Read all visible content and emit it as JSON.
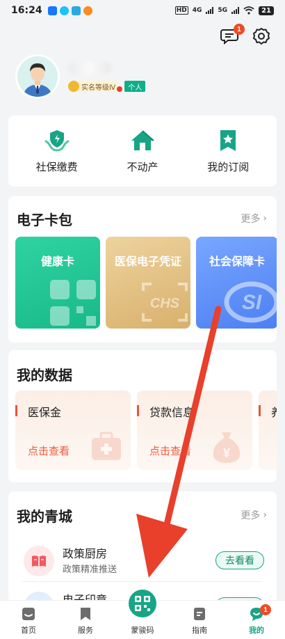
{
  "status": {
    "time": "16:24",
    "net1": "4G",
    "net2": "5G",
    "battery": "21",
    "hd": "HD"
  },
  "header": {
    "message_badge": "1"
  },
  "profile": {
    "level_badge": "实名等级Ⅳ",
    "type_badge": "个人"
  },
  "quick_actions": [
    {
      "label": "社保缴费",
      "icon": "shield-hand-icon"
    },
    {
      "label": "不动产",
      "icon": "house-icon"
    },
    {
      "label": "我的订阅",
      "icon": "bookmark-star-icon"
    }
  ],
  "wallet": {
    "title": "电子卡包",
    "more": "更多",
    "cards": [
      {
        "label": "健康卡",
        "color": "#1fc08f"
      },
      {
        "label": "医保电子凭证",
        "color": "#e2c07f"
      },
      {
        "label": "社会保障卡",
        "color": "#5b8cf5"
      }
    ]
  },
  "my_data": {
    "title": "我的数据",
    "items": [
      {
        "label": "医保金",
        "link": "点击查看"
      },
      {
        "label": "贷款信息",
        "link": "点击查看"
      },
      {
        "label": "养"
      }
    ]
  },
  "my_city": {
    "title": "我的青城",
    "more": "更多",
    "items": [
      {
        "title": "政策厨房",
        "subtitle": "政策精准推送",
        "button": "去看看"
      },
      {
        "title": "电子印章",
        "button": "去看看"
      }
    ]
  },
  "tabbar": {
    "items": [
      {
        "label": "首页"
      },
      {
        "label": "服务"
      },
      {
        "label": "蒙骏码"
      },
      {
        "label": "指南"
      },
      {
        "label": "我的",
        "badge": "1"
      }
    ],
    "active_color": "#17a586"
  },
  "annotation_color": "#e8402b"
}
